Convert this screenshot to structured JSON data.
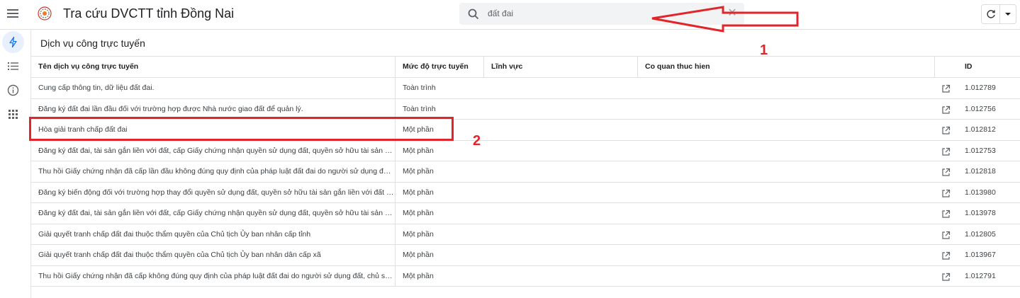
{
  "app": {
    "title": "Tra cứu DVCTT tỉnh Đồng Nai"
  },
  "search": {
    "value": "đất đai",
    "placeholder": "",
    "icon": "search-icon",
    "clear_icon": "close-icon"
  },
  "toolbar": {
    "refresh_icon": "refresh-icon",
    "dropdown_icon": "chevron-down-icon"
  },
  "sidebar": {
    "items": [
      {
        "name": "bolt-icon",
        "active": true
      },
      {
        "name": "list-icon",
        "active": false
      },
      {
        "name": "info-icon",
        "active": false
      },
      {
        "name": "apps-grid-icon",
        "active": false
      }
    ]
  },
  "section": {
    "title": "Dịch vụ công trực tuyến"
  },
  "table": {
    "columns": [
      "Tên dịch vụ công trực tuyến",
      "Mức độ trực tuyến",
      "Lĩnh vực",
      "Co quan thuc hien",
      "ID"
    ],
    "rows": [
      {
        "name": "Cung cấp thông tin, dữ liệu đất đai.",
        "level": "Toàn trình",
        "field": "",
        "agency": "",
        "id": "1.012789"
      },
      {
        "name": "Đăng ký đất đai lần đầu đối với trường hợp được Nhà nước giao đất để quản lý.",
        "level": "Toàn trình",
        "field": "",
        "agency": "",
        "id": "1.012756"
      },
      {
        "name": "Hòa giải tranh chấp đất đai",
        "level": "Một phần",
        "field": "",
        "agency": "",
        "id": "1.012812"
      },
      {
        "name": "Đăng ký đất đai, tài sản gắn liền với đất, cấp Giấy chứng nhận quyền sử dụng đất, quyền sở hữu tài sản gắn liền...",
        "level": "Một phần",
        "field": "",
        "agency": "",
        "id": "1.012753"
      },
      {
        "name": "Thu hồi Giấy chứng nhận đã cấp lần đầu không đúng quy định của pháp luật đất đai do người sử dụng đất, chủ ...",
        "level": "Một phần",
        "field": "",
        "agency": "",
        "id": "1.012818"
      },
      {
        "name": "Đăng ký biến động đối với trường hợp thay đổi quyền sử dụng đất, quyền sở hữu tài sản gắn liền với đất theo th...",
        "level": "Một phần",
        "field": "",
        "agency": "",
        "id": "1.013980"
      },
      {
        "name": "Đăng ký đất đai, tài sản gắn liền với đất, cấp Giấy chứng nhận quyền sử dụng đất, quyền sở hữu tài sản gắn liền...",
        "level": "Một phần",
        "field": "",
        "agency": "",
        "id": "1.013978"
      },
      {
        "name": "Giải quyết tranh chấp đất đai thuộc thẩm quyền của Chủ tịch Ủy ban nhân cấp tỉnh",
        "level": "Một phần",
        "field": "",
        "agency": "",
        "id": "1.012805"
      },
      {
        "name": "Giải quyết tranh chấp đất đai thuộc thẩm quyền của Chủ tịch Ủy ban nhân dân cấp xã",
        "level": "Một phần",
        "field": "",
        "agency": "",
        "id": "1.013967"
      },
      {
        "name": "Thu hồi Giấy chứng nhận đã cấp không đúng quy định của pháp luật đất đai do người sử dụng đất, chủ sở hữu t...",
        "level": "Một phần",
        "field": "",
        "agency": "",
        "id": "1.012791"
      }
    ],
    "row_action_icon": "open-in-new-icon"
  },
  "annotations": {
    "label_1": "1",
    "label_2": "2",
    "color": "#e0262b"
  }
}
